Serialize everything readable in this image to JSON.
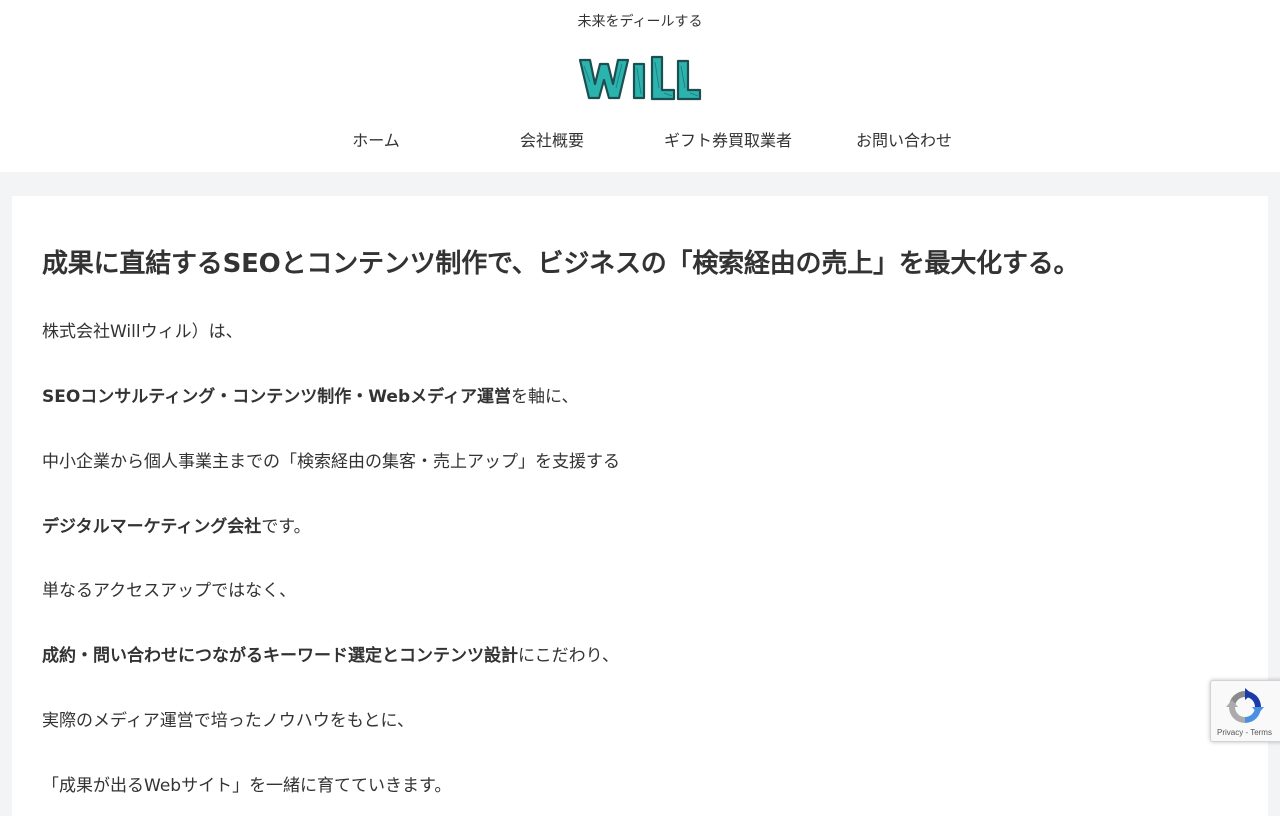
{
  "header": {
    "tagline": "未来をディールする",
    "logo_text": "WILL",
    "nav": [
      "ホーム",
      "会社概要",
      "ギフト券買取業者",
      "お問い合わせ"
    ]
  },
  "main": {
    "headline": "成果に直結するSEOとコンテンツ制作で、ビジネスの「検索経由の売上」を最大化する。",
    "paragraphs": [
      {
        "bold": "",
        "text": "株式会社Willウィル）は、"
      },
      {
        "bold": "SEOコンサルティング・コンテンツ制作・Webメディア運営",
        "text": "を軸に、"
      },
      {
        "bold": "",
        "text": "中小企業から個人事業主までの「検索経由の集客・売上アップ」を支援する"
      },
      {
        "bold": "デジタルマーケティング会社",
        "text": "です。"
      },
      {
        "bold": "",
        "text": "単なるアクセスアップではなく、"
      },
      {
        "bold": "成約・問い合わせにつながるキーワード選定とコンテンツ設計",
        "text": "にこだわり、"
      },
      {
        "bold": "",
        "text": "実際のメディア運営で培ったノウハウをもとに、"
      },
      {
        "bold": "",
        "text": "「成果が出るWebサイト」を一緒に育てていきます。"
      }
    ]
  },
  "recaptcha": {
    "terms": "Privacy - Terms"
  },
  "colors": {
    "logo_teal": "#2bb3ad",
    "logo_dark": "#1d4f52",
    "page_bg": "#f3f4f6"
  }
}
